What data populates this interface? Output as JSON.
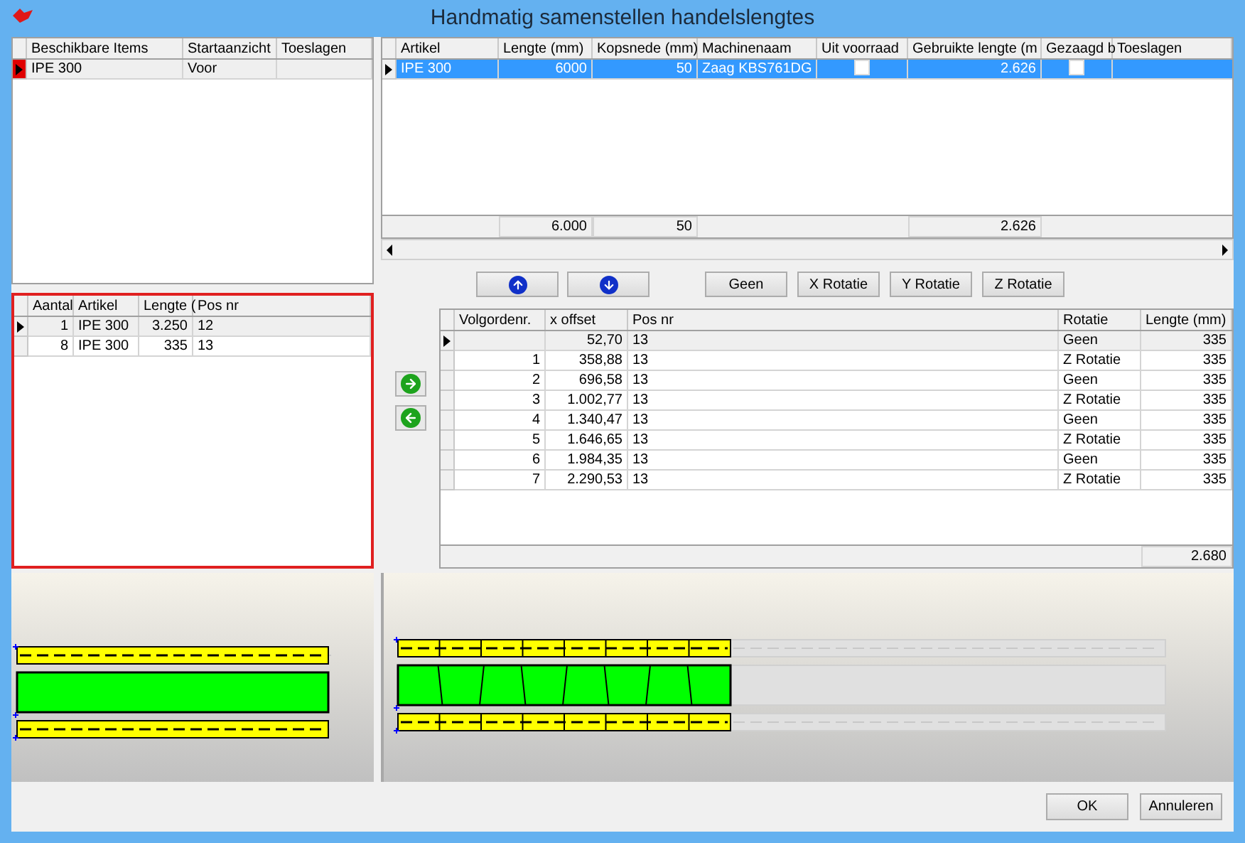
{
  "window": {
    "title": "Handmatig samenstellen handelslengtes"
  },
  "items_table": {
    "columns": [
      "Beschikbare Items",
      "Startaanzicht",
      "Toeslagen"
    ],
    "rows": [
      {
        "selected": true,
        "cells": [
          "IPE 300",
          "Voor",
          ""
        ]
      }
    ]
  },
  "articles_table": {
    "columns": [
      "Artikel",
      "Lengte (mm)",
      "Kopsnede (mm)",
      "Machinenaam",
      "Uit voorraad",
      "Gebruikte lengte (m",
      "Gezaagd b",
      "Toeslagen"
    ],
    "rows": [
      {
        "selected": true,
        "artikel": "IPE 300",
        "lengte": "6000",
        "kopsnede": "50",
        "machinenaam": "Zaag KBS761DG",
        "uit_voorraad": false,
        "gebruikte_lengte": "2.626",
        "gezaagd": false
      }
    ],
    "totals": {
      "lengte": "6.000",
      "kopsnede": "50",
      "gebruikte_lengte": "2.626"
    }
  },
  "parts_table": {
    "columns": [
      "Aantal",
      "Artikel",
      "Lengte (",
      "Pos nr"
    ],
    "rows": [
      {
        "selected": true,
        "cells": [
          "1",
          "IPE 300",
          "3.250",
          "12"
        ]
      },
      {
        "selected": false,
        "cells": [
          "8",
          "IPE 300",
          "335",
          "13"
        ]
      }
    ]
  },
  "rotation_buttons": [
    "Geen",
    "X Rotatie",
    "Y Rotatie",
    "Z Rotatie"
  ],
  "sequence_table": {
    "columns": [
      "Volgordenr.",
      "x offset",
      "Pos nr",
      "Rotatie",
      "Lengte (mm)"
    ],
    "rows": [
      {
        "selected": true,
        "cells": [
          "",
          "52,70",
          "13",
          "Geen",
          "335"
        ]
      },
      {
        "selected": false,
        "cells": [
          "1",
          "358,88",
          "13",
          "Z Rotatie",
          "335"
        ]
      },
      {
        "selected": false,
        "cells": [
          "2",
          "696,58",
          "13",
          "Geen",
          "335"
        ]
      },
      {
        "selected": false,
        "cells": [
          "3",
          "1.002,77",
          "13",
          "Z Rotatie",
          "335"
        ]
      },
      {
        "selected": false,
        "cells": [
          "4",
          "1.340,47",
          "13",
          "Geen",
          "335"
        ]
      },
      {
        "selected": false,
        "cells": [
          "5",
          "1.646,65",
          "13",
          "Z Rotatie",
          "335"
        ]
      },
      {
        "selected": false,
        "cells": [
          "6",
          "1.984,35",
          "13",
          "Geen",
          "335"
        ]
      },
      {
        "selected": false,
        "cells": [
          "7",
          "2.290,53",
          "13",
          "Z Rotatie",
          "335"
        ]
      }
    ],
    "total": "2.680"
  },
  "buttons": [
    "OK",
    "Annuleren"
  ]
}
